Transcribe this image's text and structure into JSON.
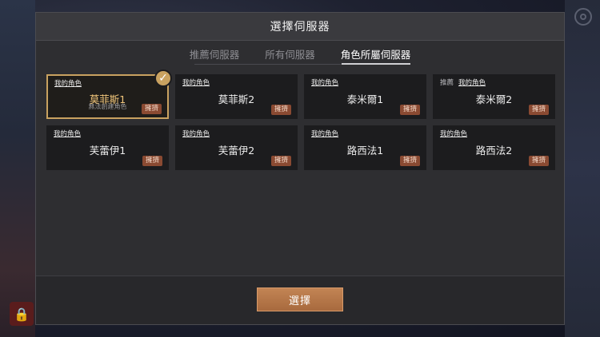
{
  "modal": {
    "title": "選擇伺服器"
  },
  "tabs": [
    {
      "label": "推薦伺服器",
      "active": false
    },
    {
      "label": "所有伺服器",
      "active": false
    },
    {
      "label": "角色所屬伺服器",
      "active": true
    }
  ],
  "servers": [
    {
      "tag": "我的角色",
      "recommend": "",
      "name": "莫菲斯1",
      "note": "無法創建角色",
      "status": "擁擠",
      "selected": true
    },
    {
      "tag": "我的角色",
      "recommend": "",
      "name": "莫菲斯2",
      "note": "",
      "status": "擁擠",
      "selected": false
    },
    {
      "tag": "我的角色",
      "recommend": "",
      "name": "泰米爾1",
      "note": "",
      "status": "擁擠",
      "selected": false
    },
    {
      "tag": "我的角色",
      "recommend": "推薦",
      "name": "泰米爾2",
      "note": "",
      "status": "擁擠",
      "selected": false
    },
    {
      "tag": "我的角色",
      "recommend": "",
      "name": "芙蕾伊1",
      "note": "",
      "status": "擁擠",
      "selected": false
    },
    {
      "tag": "我的角色",
      "recommend": "",
      "name": "芙蕾伊2",
      "note": "",
      "status": "擁擠",
      "selected": false
    },
    {
      "tag": "我的角色",
      "recommend": "",
      "name": "路西法1",
      "note": "",
      "status": "擁擠",
      "selected": false
    },
    {
      "tag": "我的角色",
      "recommend": "",
      "name": "路西法2",
      "note": "",
      "status": "擁擠",
      "selected": false
    }
  ],
  "footer": {
    "select_label": "選擇"
  },
  "icons": {
    "settings": "gear-icon",
    "lock": "lock-icon",
    "check": "check-icon"
  },
  "colors": {
    "accent_gold": "#c9a260",
    "button": "#b5774a",
    "badge": "#8a4a32"
  }
}
